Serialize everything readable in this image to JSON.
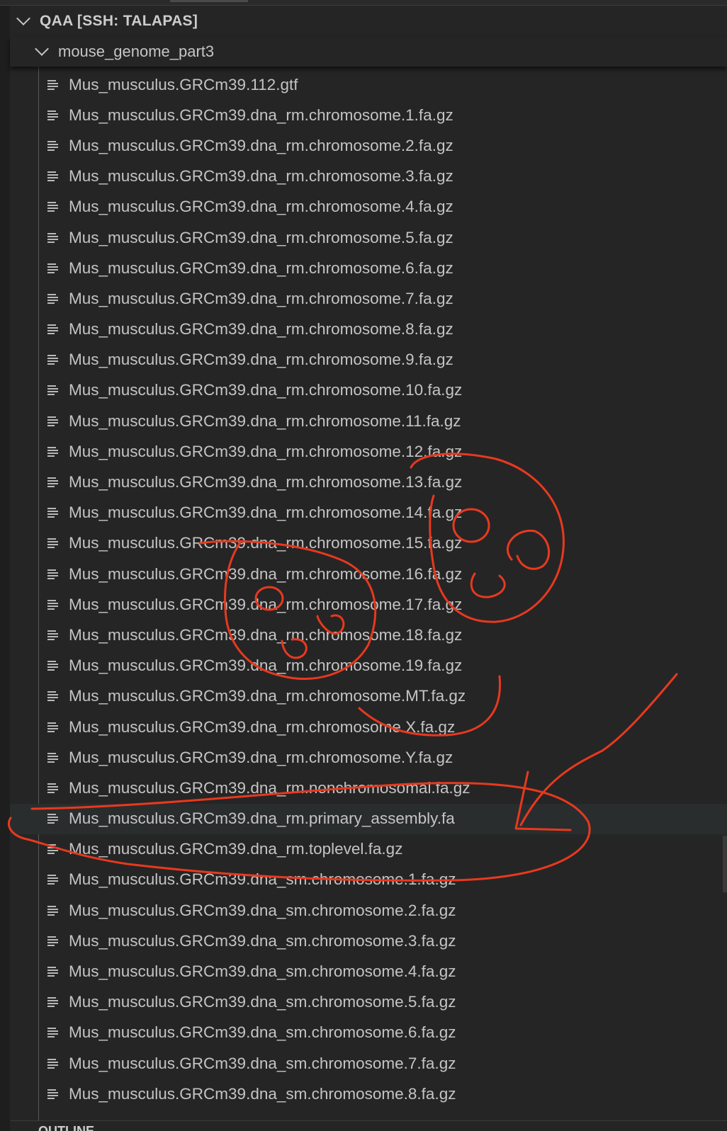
{
  "explorer": {
    "section_title": "QAA [SSH: TALAPAS]",
    "folder_name": "mouse_genome_part3",
    "files": [
      "Mus_musculus.GRCm39.112.gtf",
      "Mus_musculus.GRCm39.dna_rm.chromosome.1.fa.gz",
      "Mus_musculus.GRCm39.dna_rm.chromosome.2.fa.gz",
      "Mus_musculus.GRCm39.dna_rm.chromosome.3.fa.gz",
      "Mus_musculus.GRCm39.dna_rm.chromosome.4.fa.gz",
      "Mus_musculus.GRCm39.dna_rm.chromosome.5.fa.gz",
      "Mus_musculus.GRCm39.dna_rm.chromosome.6.fa.gz",
      "Mus_musculus.GRCm39.dna_rm.chromosome.7.fa.gz",
      "Mus_musculus.GRCm39.dna_rm.chromosome.8.fa.gz",
      "Mus_musculus.GRCm39.dna_rm.chromosome.9.fa.gz",
      "Mus_musculus.GRCm39.dna_rm.chromosome.10.fa.gz",
      "Mus_musculus.GRCm39.dna_rm.chromosome.11.fa.gz",
      "Mus_musculus.GRCm39.dna_rm.chromosome.12.fa.gz",
      "Mus_musculus.GRCm39.dna_rm.chromosome.13.fa.gz",
      "Mus_musculus.GRCm39.dna_rm.chromosome.14.fa.gz",
      "Mus_musculus.GRCm39.dna_rm.chromosome.15.fa.gz",
      "Mus_musculus.GRCm39.dna_rm.chromosome.16.fa.gz",
      "Mus_musculus.GRCm39.dna_rm.chromosome.17.fa.gz",
      "Mus_musculus.GRCm39.dna_rm.chromosome.18.fa.gz",
      "Mus_musculus.GRCm39.dna_rm.chromosome.19.fa.gz",
      "Mus_musculus.GRCm39.dna_rm.chromosome.MT.fa.gz",
      "Mus_musculus.GRCm39.dna_rm.chromosome.X.fa.gz",
      "Mus_musculus.GRCm39.dna_rm.chromosome.Y.fa.gz",
      "Mus_musculus.GRCm39.dna_rm.nonchromosomal.fa.gz",
      "Mus_musculus.GRCm39.dna_rm.primary_assembly.fa",
      "Mus_musculus.GRCm39.dna_rm.toplevel.fa.gz",
      "Mus_musculus.GRCm39.dna_sm.chromosome.1.fa.gz",
      "Mus_musculus.GRCm39.dna_sm.chromosome.2.fa.gz",
      "Mus_musculus.GRCm39.dna_sm.chromosome.3.fa.gz",
      "Mus_musculus.GRCm39.dna_sm.chromosome.4.fa.gz",
      "Mus_musculus.GRCm39.dna_sm.chromosome.5.fa.gz",
      "Mus_musculus.GRCm39.dna_sm.chromosome.6.fa.gz",
      "Mus_musculus.GRCm39.dna_sm.chromosome.7.fa.gz",
      "Mus_musculus.GRCm39.dna_sm.chromosome.8.fa.gz"
    ],
    "hovered_file": "Mus_musculus.GRCm39.dna_rm.primary_assembly.fa",
    "file_icon": "file-text-lines-icon",
    "chevron_icon": "chevron-down-icon"
  },
  "outline_section": {
    "title": "OUTLINE"
  },
  "colors": {
    "background": "#1e1e1e",
    "panel": "#252526",
    "text": "#cccccc",
    "hover_row": "#2a2d2e",
    "annotation": "#e8391e"
  }
}
